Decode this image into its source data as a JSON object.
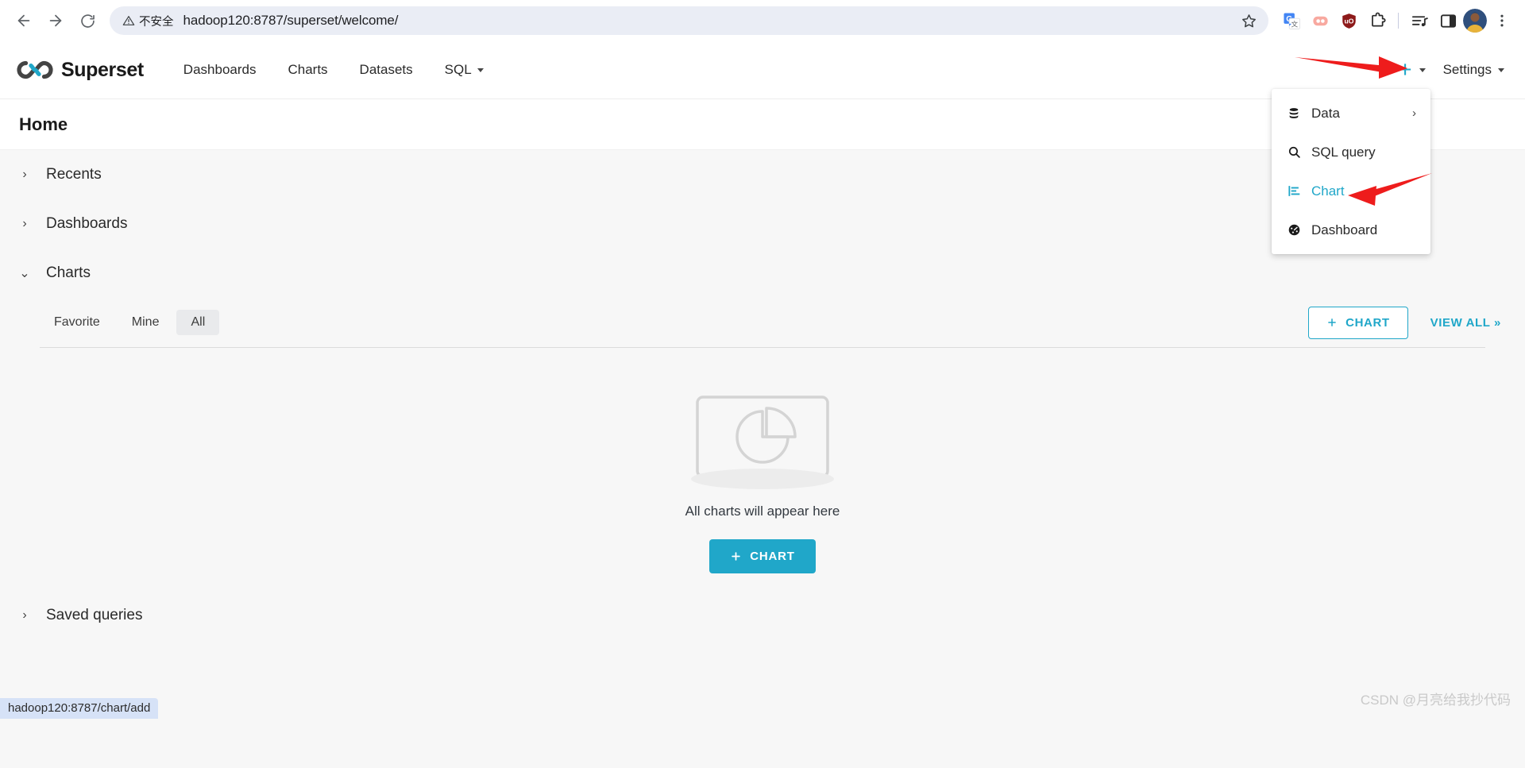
{
  "browser": {
    "back_label": "back-arrow",
    "forward_label": "forward-arrow",
    "reload_label": "reload",
    "security_text": "不安全",
    "url": "hadoop120:8787/superset/welcome/",
    "extensions": [
      "google-translate",
      "pocket",
      "ublock-origin",
      "extensions-puzzle",
      "reading-list",
      "side-panel"
    ],
    "status_url": "hadoop120:8787/chart/add"
  },
  "nav": {
    "brand": "Superset",
    "links": [
      {
        "label": "Dashboards",
        "has_caret": false
      },
      {
        "label": "Charts",
        "has_caret": false
      },
      {
        "label": "Datasets",
        "has_caret": false
      },
      {
        "label": "SQL",
        "has_caret": true
      }
    ],
    "plus_label": "+",
    "settings_label": "Settings"
  },
  "dropdown": {
    "items": [
      {
        "label": "Data",
        "icon": "database-icon",
        "has_submenu": true,
        "active": false
      },
      {
        "label": "SQL query",
        "icon": "search-icon",
        "has_submenu": false,
        "active": false
      },
      {
        "label": "Chart",
        "icon": "bar-chart-icon",
        "has_submenu": false,
        "active": true
      },
      {
        "label": "Dashboard",
        "icon": "dashboard-icon",
        "has_submenu": false,
        "active": false
      }
    ]
  },
  "page": {
    "title": "Home"
  },
  "sections": {
    "recents": {
      "label": "Recents",
      "expanded": false
    },
    "dashboards": {
      "label": "Dashboards",
      "expanded": false
    },
    "charts": {
      "label": "Charts",
      "expanded": true
    },
    "saved_queries": {
      "label": "Saved queries",
      "expanded": false
    }
  },
  "charts_panel": {
    "tabs": [
      {
        "label": "Favorite",
        "selected": false
      },
      {
        "label": "Mine",
        "selected": false
      },
      {
        "label": "All",
        "selected": true
      }
    ],
    "add_chart_label": "CHART",
    "view_all_label": "VIEW ALL »",
    "empty_text": "All charts will appear here",
    "empty_button_label": "CHART"
  },
  "watermark": "CSDN @月亮给我抄代码",
  "colors": {
    "accent": "#20a7c9",
    "arrow": "#ee1c1c",
    "page_bg": "#f7f7f7",
    "panel_bg": "#ffffff"
  }
}
